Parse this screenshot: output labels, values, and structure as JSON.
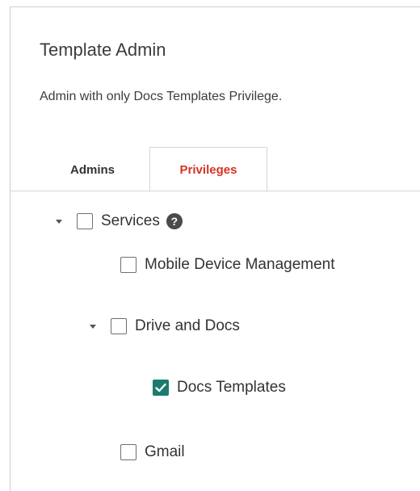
{
  "header": {
    "title": "Template Admin",
    "description": "Admin with only Docs Templates Privilege."
  },
  "tabs": [
    {
      "label": "Admins",
      "active": false
    },
    {
      "label": "Privileges",
      "active": true
    }
  ],
  "privileges": {
    "services": {
      "label": "Services",
      "checked": false,
      "expanded": true,
      "help_icon": "question-circle-icon"
    },
    "mdm": {
      "label": "Mobile Device Management",
      "checked": false
    },
    "drive": {
      "label": "Drive and Docs",
      "checked": false,
      "expanded": true
    },
    "docs_templates": {
      "label": "Docs Templates",
      "checked": true
    },
    "gmail": {
      "label": "Gmail",
      "checked": false
    }
  },
  "colors": {
    "active_tab": "#d93025",
    "checkbox_checked": "#1a7b6e"
  }
}
